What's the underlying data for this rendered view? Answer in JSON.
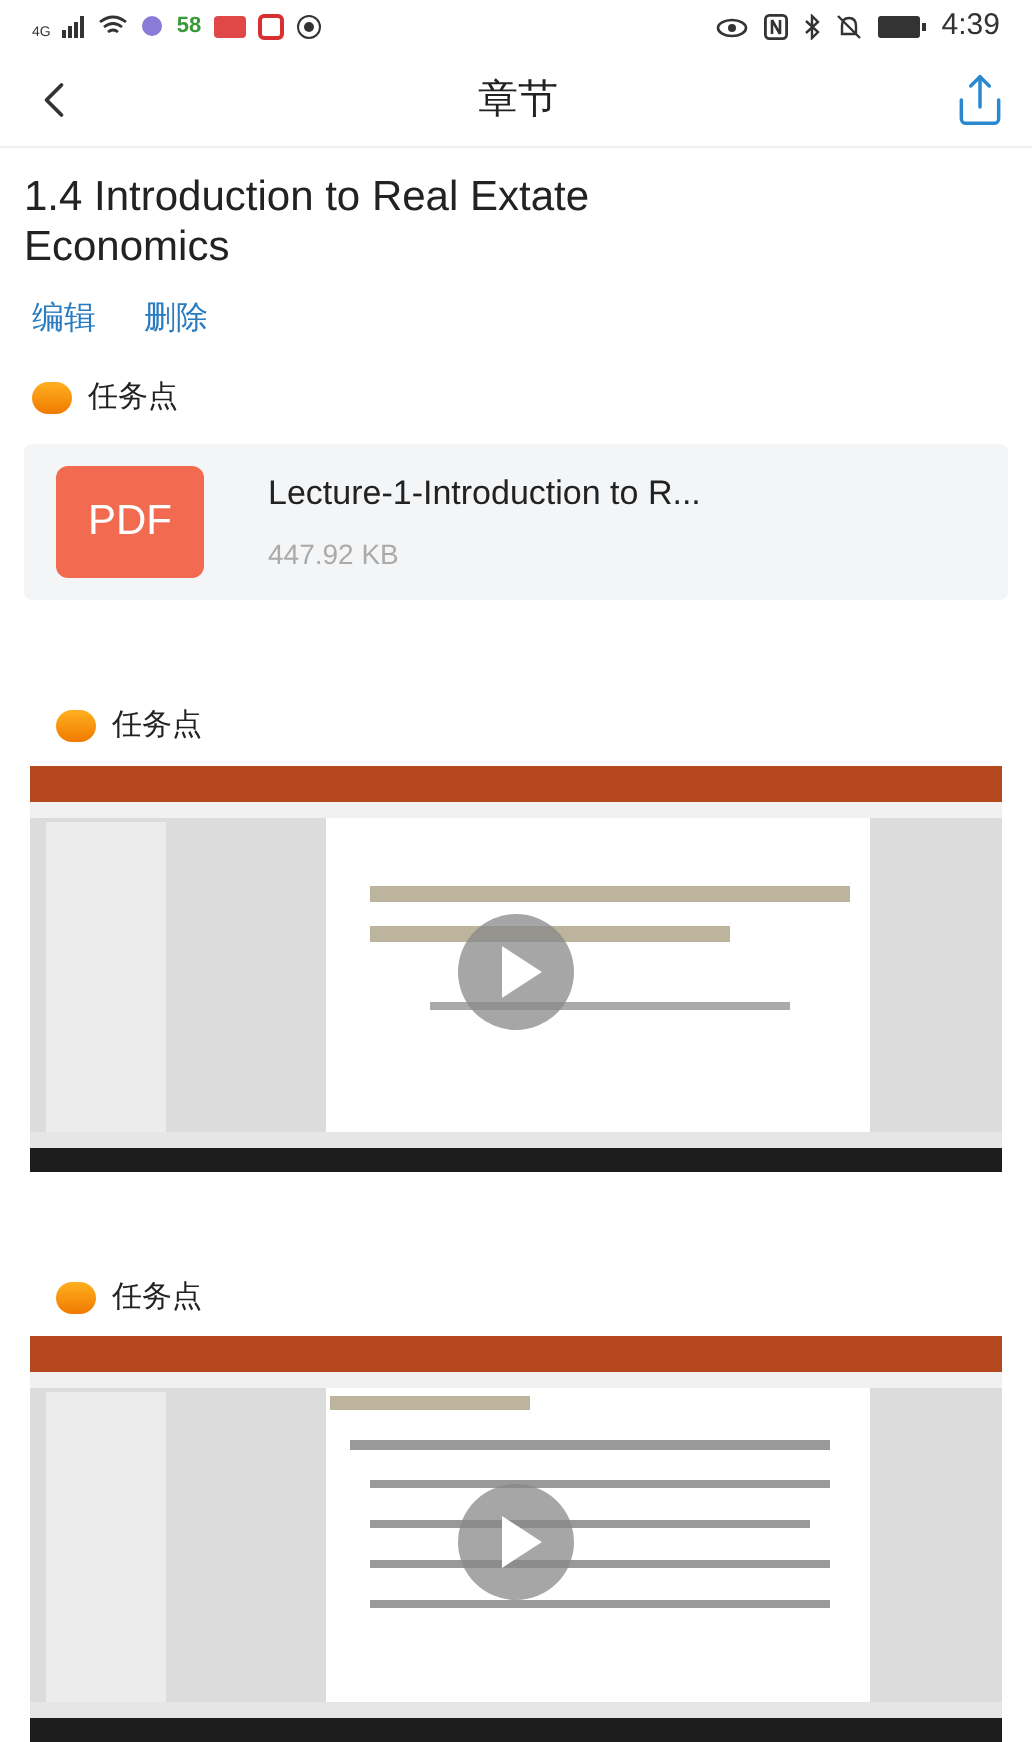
{
  "status_bar": {
    "network": "4G",
    "app_badge": "58",
    "time": "4:39"
  },
  "header": {
    "title": "章节"
  },
  "chapter": {
    "title": "1.4 Introduction to Real Extate Economics",
    "actions": [
      "编辑",
      "删除"
    ]
  },
  "tasks": [
    {
      "label": "任务点",
      "kind": "file",
      "file_type": "PDF",
      "file_name": "Lecture-1-Introduction to R...",
      "file_size": "447.92 KB"
    },
    {
      "label": "任务点",
      "kind": "video"
    },
    {
      "label": "任务点",
      "kind": "video"
    }
  ]
}
